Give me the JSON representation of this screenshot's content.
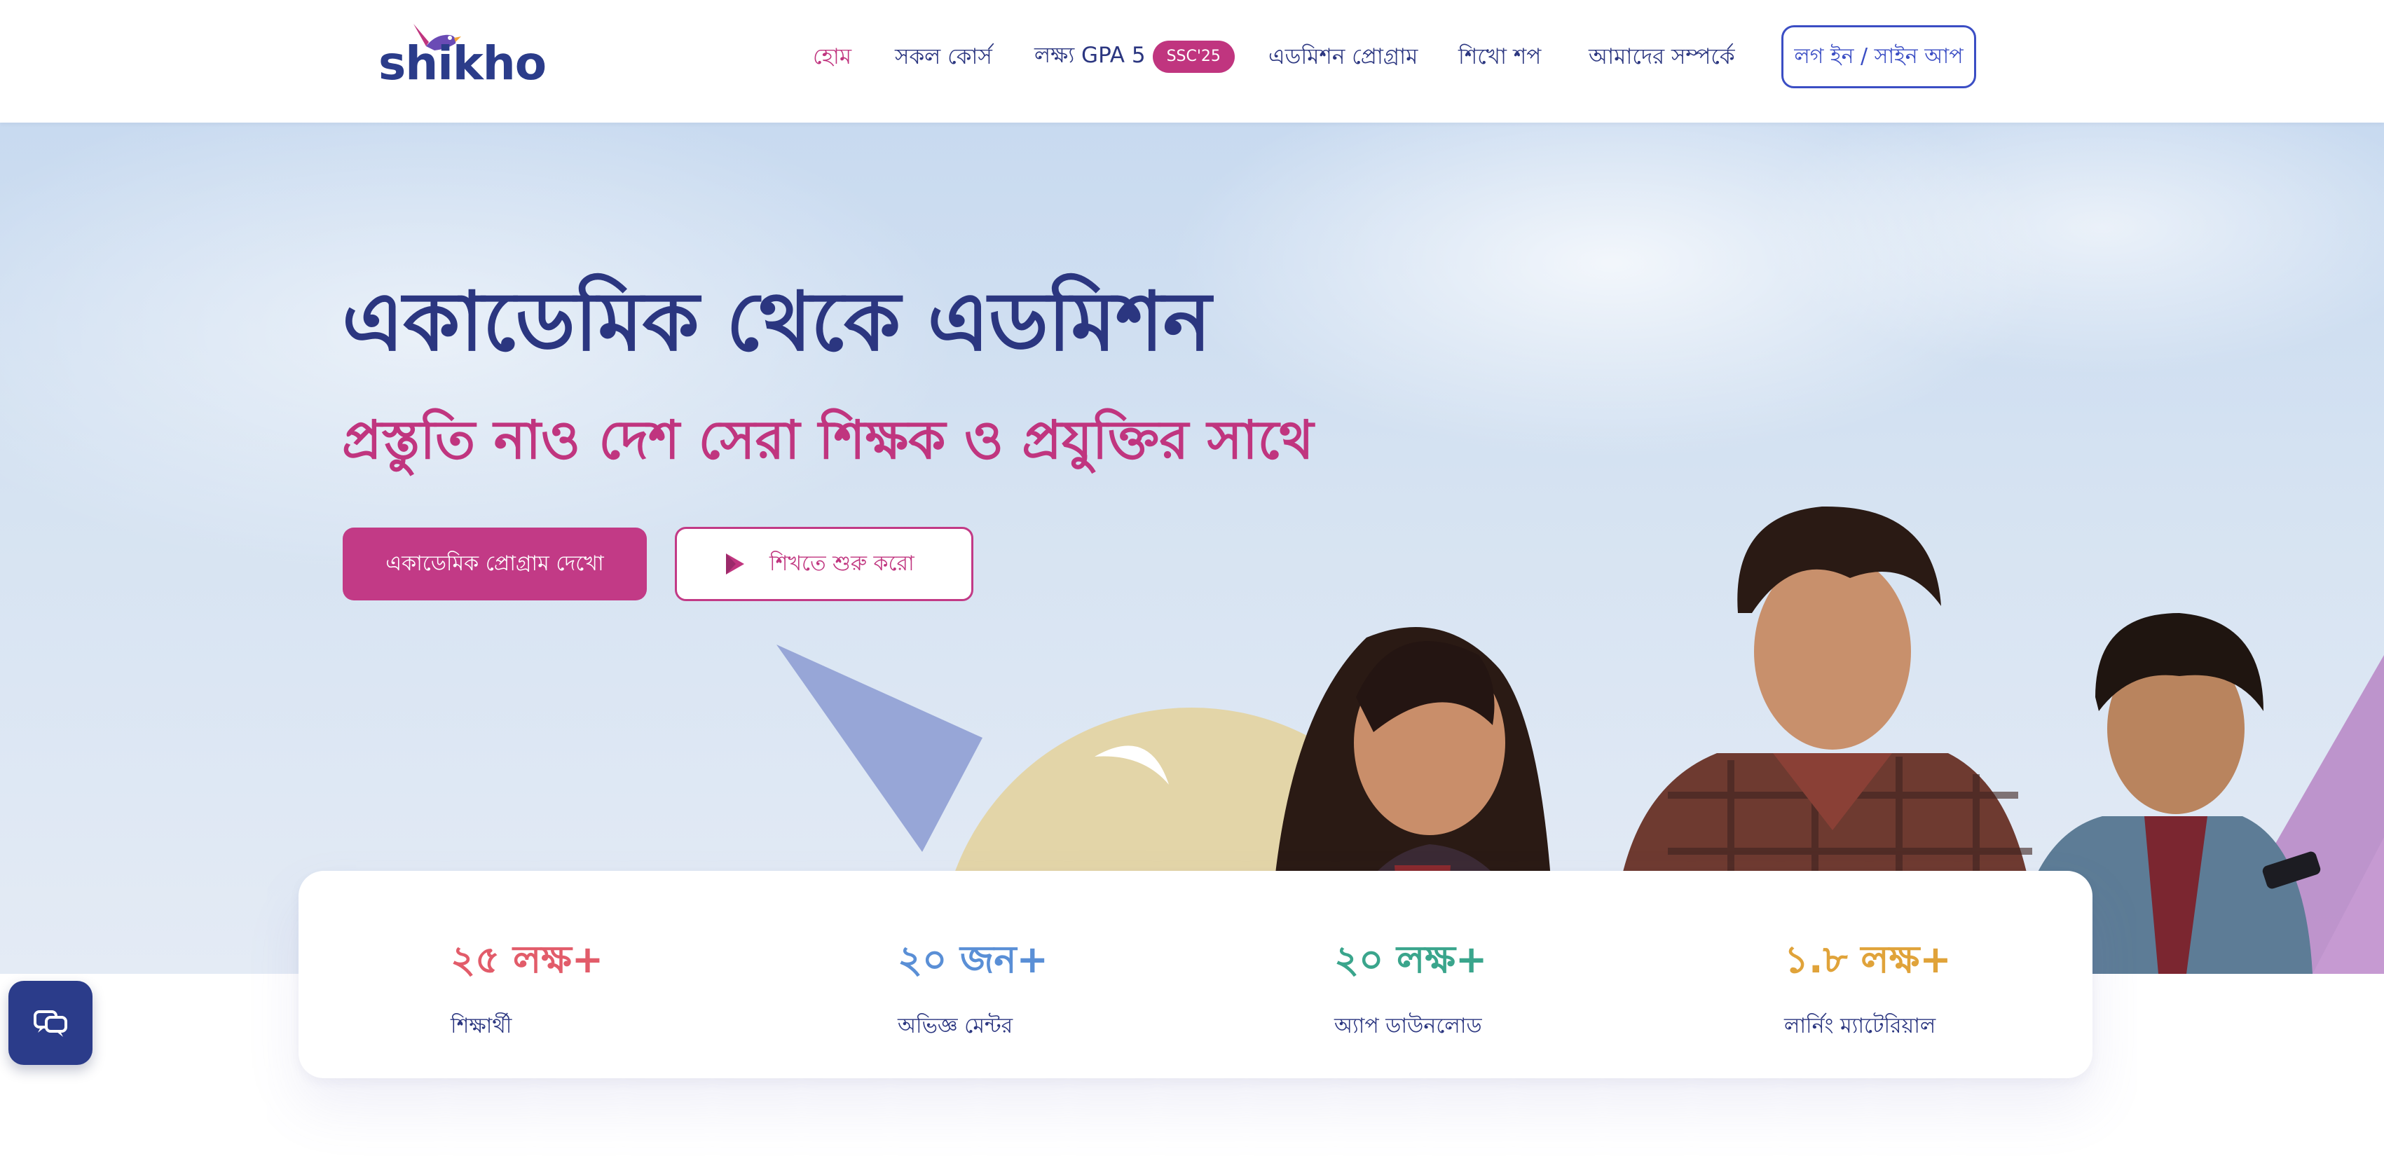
{
  "brand": {
    "name": "shikho",
    "primary": "#2b3680",
    "accent": "#c0357f"
  },
  "nav": {
    "links": [
      {
        "label": "হোম",
        "active": true
      },
      {
        "label": "সকল কোর্স",
        "active": false
      },
      {
        "label": "লক্ষ্য GPA 5",
        "badge": "SSC'25",
        "active": false
      },
      {
        "label": "এডমিশন প্রোগ্রাম",
        "active": false
      },
      {
        "label": "শিখো শপ",
        "active": false
      },
      {
        "label": "আমাদের সম্পর্কে",
        "active": false
      }
    ],
    "login_label": "লগ ইন / সাইন আপ"
  },
  "hero": {
    "title": "একাডেমিক থেকে এডমিশন",
    "subtitle": "প্রস্তুতি নাও দেশ সেরা শিক্ষক ও প্রযুক্তির সাথে",
    "primary_button": "একাডেমিক প্রোগ্রাম দেখো",
    "secondary_button": "শিখতে শুরু করো",
    "secondary_icon": "play-icon"
  },
  "stats": [
    {
      "value": "২৫ লক্ষ+",
      "label": "শিক্ষার্থী",
      "color": "#e25c6a"
    },
    {
      "value": "২০ জন+",
      "label": "অভিজ্ঞ মেন্টর",
      "color": "#5a8fd6"
    },
    {
      "value": "২০ লক্ষ+",
      "label": "অ্যাপ ডাউনলোড",
      "color": "#3aa58c"
    },
    {
      "value": "১.৮ লক্ষ+",
      "label": "লার্নিং ম্যাটেরিয়াল",
      "color": "#e0a33a"
    }
  ],
  "chat": {
    "icon": "chat-icon"
  }
}
